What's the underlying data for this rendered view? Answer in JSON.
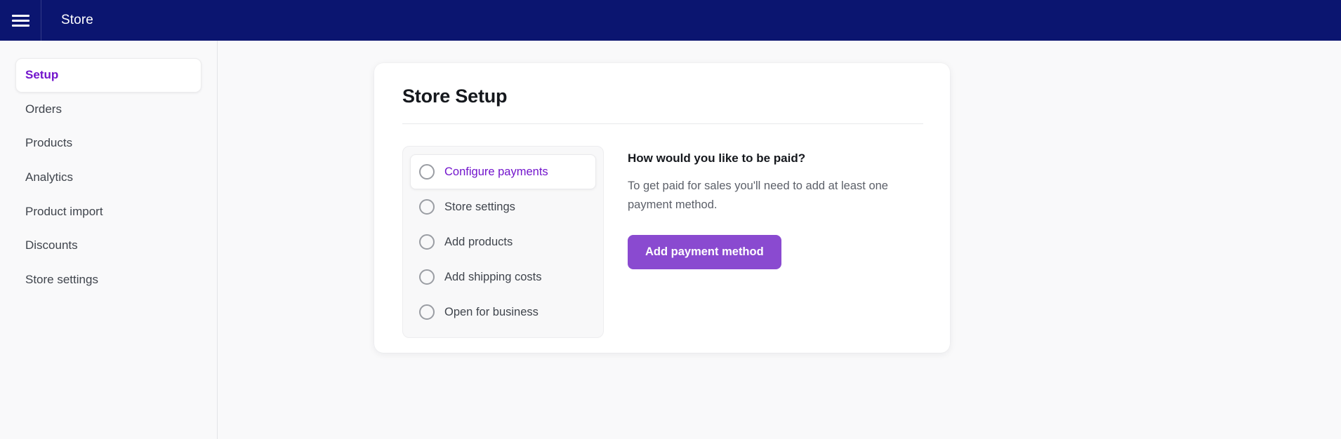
{
  "topbar": {
    "menu_icon": "hamburger-menu-icon",
    "title": "Store"
  },
  "sidebar": {
    "items": [
      {
        "label": "Setup",
        "active": true
      },
      {
        "label": "Orders",
        "active": false
      },
      {
        "label": "Products",
        "active": false
      },
      {
        "label": "Analytics",
        "active": false
      },
      {
        "label": "Product import",
        "active": false
      },
      {
        "label": "Discounts",
        "active": false
      },
      {
        "label": "Store settings",
        "active": false
      }
    ]
  },
  "card": {
    "title": "Store Setup",
    "checklist": [
      {
        "label": "Configure payments",
        "active": true,
        "checked": false
      },
      {
        "label": "Store settings",
        "active": false,
        "checked": false
      },
      {
        "label": "Add products",
        "active": false,
        "checked": false
      },
      {
        "label": "Add shipping costs",
        "active": false,
        "checked": false
      },
      {
        "label": "Open for business",
        "active": false,
        "checked": false
      }
    ],
    "detail": {
      "heading": "How would you like to be paid?",
      "text": "To get paid for sales you'll need to add at least one payment method.",
      "button_label": "Add payment method"
    }
  },
  "colors": {
    "topbar_navy": "#0b1570",
    "accent_purple": "#7214cc",
    "button_purple": "#8a4ad0",
    "page_background": "#f9f9fa"
  }
}
